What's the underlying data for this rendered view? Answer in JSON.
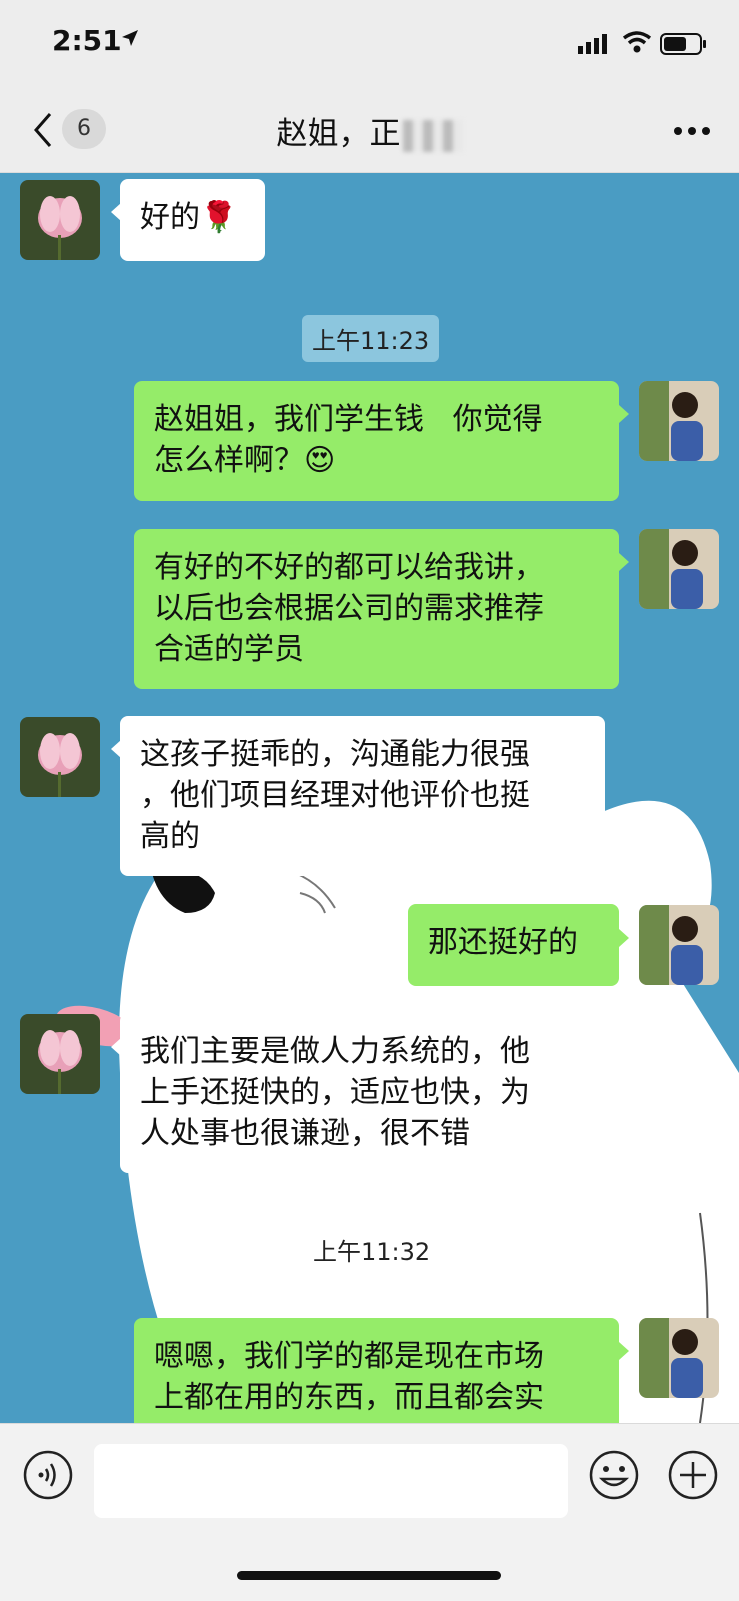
{
  "status": {
    "time": "2:51"
  },
  "header": {
    "title": "赵姐，正",
    "unread_count": "6"
  },
  "messages": [
    {
      "text": "好的",
      "emoji": "🌹"
    },
    {
      "text": "赵姐姐，我们学生钱   你觉得\n怎么样啊？",
      "emoji": "😍"
    },
    {
      "text": "有好的不好的都可以给我讲，\n以后也会根据公司的需求推荐\n合适的学员"
    },
    {
      "text": "这孩子挺乖的，沟通能力很强\n，他们项目经理对他评价也挺\n高的"
    },
    {
      "text": "那还挺好的"
    },
    {
      "text": "我们主要是做人力系统的，他\n上手还挺快的，适应也快，为\n人处事也很谦逊，很不错"
    },
    {
      "text": "嗯嗯，我们学的都是现在市场\n上都在用的东西，而且都会实"
    }
  ],
  "timestamps": [
    "上午11:23",
    "上午11:32"
  ],
  "colors": {
    "chat_bg": "#4a9cc3",
    "outgoing_bubble": "#95ec69",
    "incoming_bubble": "#ffffff"
  },
  "icons": {
    "back": "chevron-left-icon",
    "more": "more-icon",
    "voice": "voice-icon",
    "emoji": "emoji-icon",
    "plus": "plus-icon"
  }
}
